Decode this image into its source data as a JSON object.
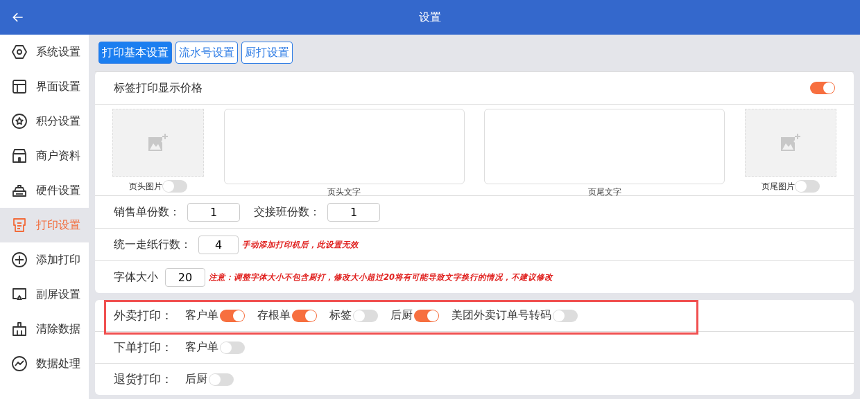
{
  "header": {
    "title": "设置"
  },
  "sidebar": {
    "items": [
      {
        "label": "系统设置",
        "selected": false
      },
      {
        "label": "界面设置",
        "selected": false
      },
      {
        "label": "积分设置",
        "selected": false
      },
      {
        "label": "商户资料",
        "selected": false
      },
      {
        "label": "硬件设置",
        "selected": false
      },
      {
        "label": "打印设置",
        "selected": true
      },
      {
        "label": "添加打印",
        "selected": false
      },
      {
        "label": "副屏设置",
        "selected": false
      },
      {
        "label": "清除数据",
        "selected": false
      },
      {
        "label": "数据处理",
        "selected": false
      }
    ]
  },
  "tabs": [
    {
      "label": "打印基本设置",
      "selected": true
    },
    {
      "label": "流水号设置",
      "selected": false
    },
    {
      "label": "厨打设置",
      "selected": false
    }
  ],
  "label_price": {
    "label": "标签打印显示价格",
    "on": true
  },
  "header_image": {
    "label": "页头图片",
    "on": false
  },
  "header_text": {
    "label": "页头文字"
  },
  "footer_text": {
    "label": "页尾文字"
  },
  "footer_image": {
    "label": "页尾图片",
    "on": false
  },
  "copies": [
    {
      "label": "销售单份数：",
      "value": "1"
    },
    {
      "label": "交接班份数：",
      "value": "1"
    }
  ],
  "feed_lines": {
    "label": "统一走纸行数：",
    "value": "4",
    "note": "手动添加打印机后，此设置无效"
  },
  "font_size": {
    "label": "字体大小",
    "value": "20",
    "note": "注意：调整字体大小不包含厨打，修改大小超过20将有可能导致文字换行的情况，不建议修改"
  },
  "print_rows": [
    {
      "label": "外卖打印：",
      "highlighted": true,
      "options": [
        {
          "label": "客户单",
          "on": true
        },
        {
          "label": "存根单",
          "on": true
        },
        {
          "label": "标签",
          "on": false
        },
        {
          "label": "后厨",
          "on": true
        },
        {
          "label": "美团外卖订单号转码",
          "on": false
        }
      ]
    },
    {
      "label": "下单打印：",
      "highlighted": false,
      "options": [
        {
          "label": "客户单",
          "on": false
        }
      ]
    },
    {
      "label": "退货打印：",
      "highlighted": false,
      "options": [
        {
          "label": "后厨",
          "on": false
        }
      ]
    }
  ]
}
